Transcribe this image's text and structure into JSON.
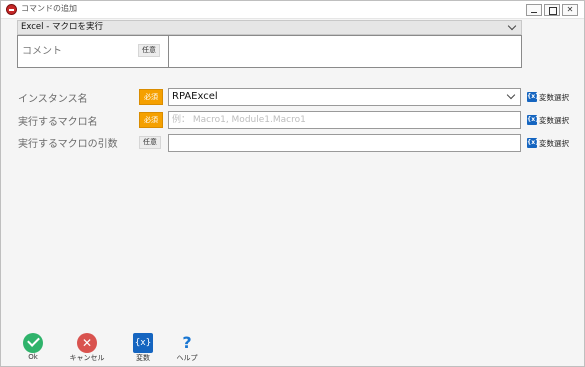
{
  "window": {
    "title": "コマンドの追加"
  },
  "action": {
    "selected": "Excel - マクロを実行"
  },
  "comment": {
    "label": "コメント",
    "badge": "任意",
    "value": ""
  },
  "rows": [
    {
      "label": "インスタンス名",
      "badge": "必須",
      "value": "RPAExcel",
      "placeholder": "",
      "type": "dropdown"
    },
    {
      "label": "実行するマクロ名",
      "badge": "必須",
      "value": "",
      "placeholder": "例： Macro1, Module1.Macro1",
      "type": "text"
    },
    {
      "label": "実行するマクロの引数",
      "badge": "任意",
      "value": "",
      "placeholder": "",
      "type": "text"
    }
  ],
  "variable_select": {
    "icon": "variable-icon",
    "label": "変数選択",
    "icon_text": "{x}"
  },
  "footer": {
    "ok": {
      "label": "Ok",
      "icon": "check-icon"
    },
    "cancel": {
      "label": "キャンセル",
      "icon": "close-icon",
      "glyph": "✕"
    },
    "variables": {
      "label": "変数",
      "icon": "variable-icon",
      "glyph": "{x}"
    },
    "help": {
      "label": "ヘルプ",
      "icon": "question-icon",
      "glyph": "?"
    }
  },
  "colors": {
    "required": "#f5a000",
    "accent": "#1565c0",
    "ok": "#2fb36b",
    "cancel": "#d9534f"
  }
}
